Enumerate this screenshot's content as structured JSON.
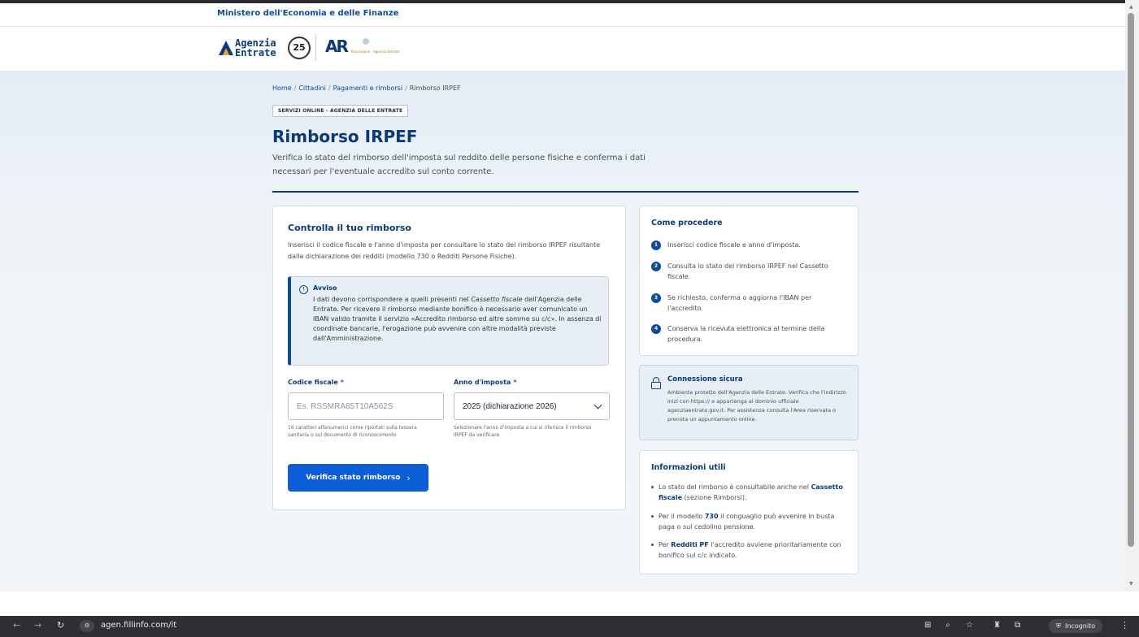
{
  "ministry": {
    "label": "Ministero dell'Economia e delle Finanze"
  },
  "logo": {
    "line1": "Agenzia",
    "line2": "Entrate",
    "anniversary": "25",
    "brand_mark": "AR",
    "brand_sub": "Riscossione · Agenzia Entrate"
  },
  "breadcrumb": {
    "home": "Home",
    "cittadini": "Cittadini",
    "pagamenti": "Pagamenti e rimborsi",
    "current": "Rimborso IRPEF",
    "separator": "/"
  },
  "hero": {
    "chip": "SERVIZI ONLINE - AGENZIA DELLE ENTRATE",
    "title": "Rimborso IRPEF",
    "subtitle": "Verifica lo stato del rimborso dell'imposta sul reddito delle persone fisiche e conferma i dati necessari per l'eventuale accredito sul conto corrente."
  },
  "form": {
    "title": "Controlla il tuo rimborso",
    "intro": "Inserisci il codice fiscale e l'anno d'imposta per consultare lo stato del rimborso IRPEF risultante dalla dichiarazione dei redditi (modello 730 o Redditi Persone Fisiche).",
    "notice": {
      "title": "Avviso",
      "body_pre": "I dati devono corrispondere a quelli presenti nel ",
      "body_em": "Cassetto fiscale",
      "body_post": " dell'Agenzia delle Entrate. Per ricevere il rimborso mediante bonifico è necessario aver comunicato un IBAN valido tramite il servizio «Accredito rimborso ed altre somme su c/c». In assenza di coordinate bancarie, l'erogazione può avvenire con altre modalità previste dall'Amministrazione."
    },
    "cf_label": "Codice fiscale",
    "cf_placeholder": "Es. RSSMRA85T10A562S",
    "cf_value": "",
    "cf_hint": "16 caratteri alfanumerici come riportati sulla tessera sanitaria o sul documento di riconoscimento",
    "anno_label": "Anno d'imposta",
    "anno_value": "2025 (dichiarazione 2026)",
    "anno_hint": "Selezionare l'anno d'imposta a cui si riferisce il rimborso IRPEF da verificare",
    "required_mark": "*",
    "submit_label": "Verifica stato rimborso",
    "submit_arrow": "›"
  },
  "steps": {
    "title": "Come procedere",
    "items": [
      {
        "num": "1",
        "text": "Inserisci codice fiscale e anno d'imposta."
      },
      {
        "num": "2",
        "text": "Consulta lo stato del rimborso IRPEF nel Cassetto fiscale."
      },
      {
        "num": "3",
        "text": "Se richiesto, conferma o aggiorna l'IBAN per l'accredito."
      },
      {
        "num": "4",
        "text": "Conserva la ricevuta elettronica al termine della procedura."
      }
    ]
  },
  "secure": {
    "title": "Connessione sicura",
    "body": "Ambiente protetto dell'Agenzia delle Entrate. Verifica che l'indirizzo inizi con https:// e appartenga al dominio ufficiale agenziaentrate.gov.it. Per assistenza consulta l'Area riservata o prenota un appuntamento online."
  },
  "info": {
    "title": "Informazioni utili",
    "item1_pre": "Lo stato del rimborso è consultabile anche nel ",
    "item1_bold": "Cassetto fiscale",
    "item1_post": " (sezione Rimborsi).",
    "item2_pre": "Per il modello ",
    "item2_bold": "730",
    "item2_post": " il conguaglio può avvenire in busta paga o sul cedolino pensione.",
    "item3_pre": "Per ",
    "item3_bold": "Redditi PF",
    "item3_post": " l'accredito avviene prioritariamente con bonifico sul c/c indicato."
  },
  "browser": {
    "url": "agen.fillinfo.com/it",
    "incognito_label": "Incognito",
    "icons": [
      "back-icon",
      "forward-icon",
      "reload-icon",
      "site-info-icon",
      "translate-icon",
      "zoom-icon",
      "bookmark-star-icon",
      "extension-icon",
      "puzzle-icon",
      "incognito-icon",
      "menu-icon"
    ]
  },
  "colors": {
    "brand_blue": "#0b3a78",
    "primary_button": "#0b5ed7",
    "required": "#c62828",
    "notice_bg": "#e8eef6"
  }
}
